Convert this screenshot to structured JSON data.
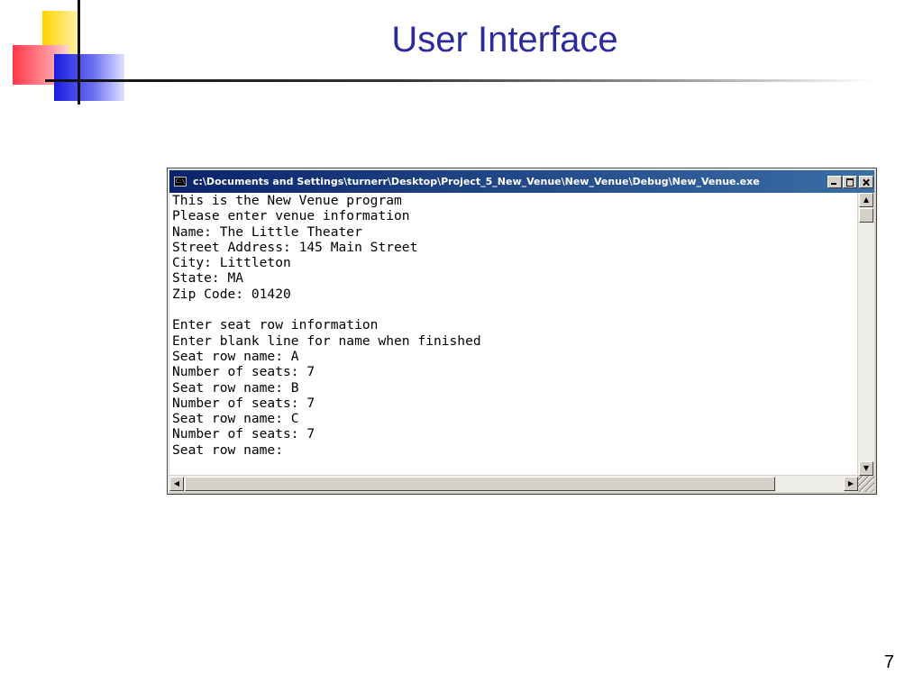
{
  "slide": {
    "title": "User Interface",
    "page_number": "7"
  },
  "window": {
    "title": "c:\\Documents and Settings\\turnerr\\Desktop\\Project_5_New_Venue\\New_Venue\\Debug\\New_Venue.exe",
    "app_icon_text": "C:\\",
    "title_bar_color": "#0a246a",
    "buttons": [
      "minimize",
      "maximize",
      "close"
    ]
  },
  "console": {
    "lines": [
      "This is the New Venue program",
      "Please enter venue information",
      "Name: The Little Theater",
      "Street Address: 145 Main Street",
      "City: Littleton",
      "State: MA",
      "Zip Code: 01420",
      "",
      "Enter seat row information",
      "Enter blank line for name when finished",
      "Seat row name: A",
      "Number of seats: 7",
      "Seat row name: B",
      "Number of seats: 7",
      "Seat row name: C",
      "Number of seats: 7",
      "Seat row name:"
    ]
  },
  "icons": {
    "scroll_up": "scroll-up-arrow-icon",
    "scroll_down": "scroll-down-arrow-icon",
    "scroll_left": "scroll-left-arrow-icon",
    "scroll_right": "scroll-right-arrow-icon"
  }
}
